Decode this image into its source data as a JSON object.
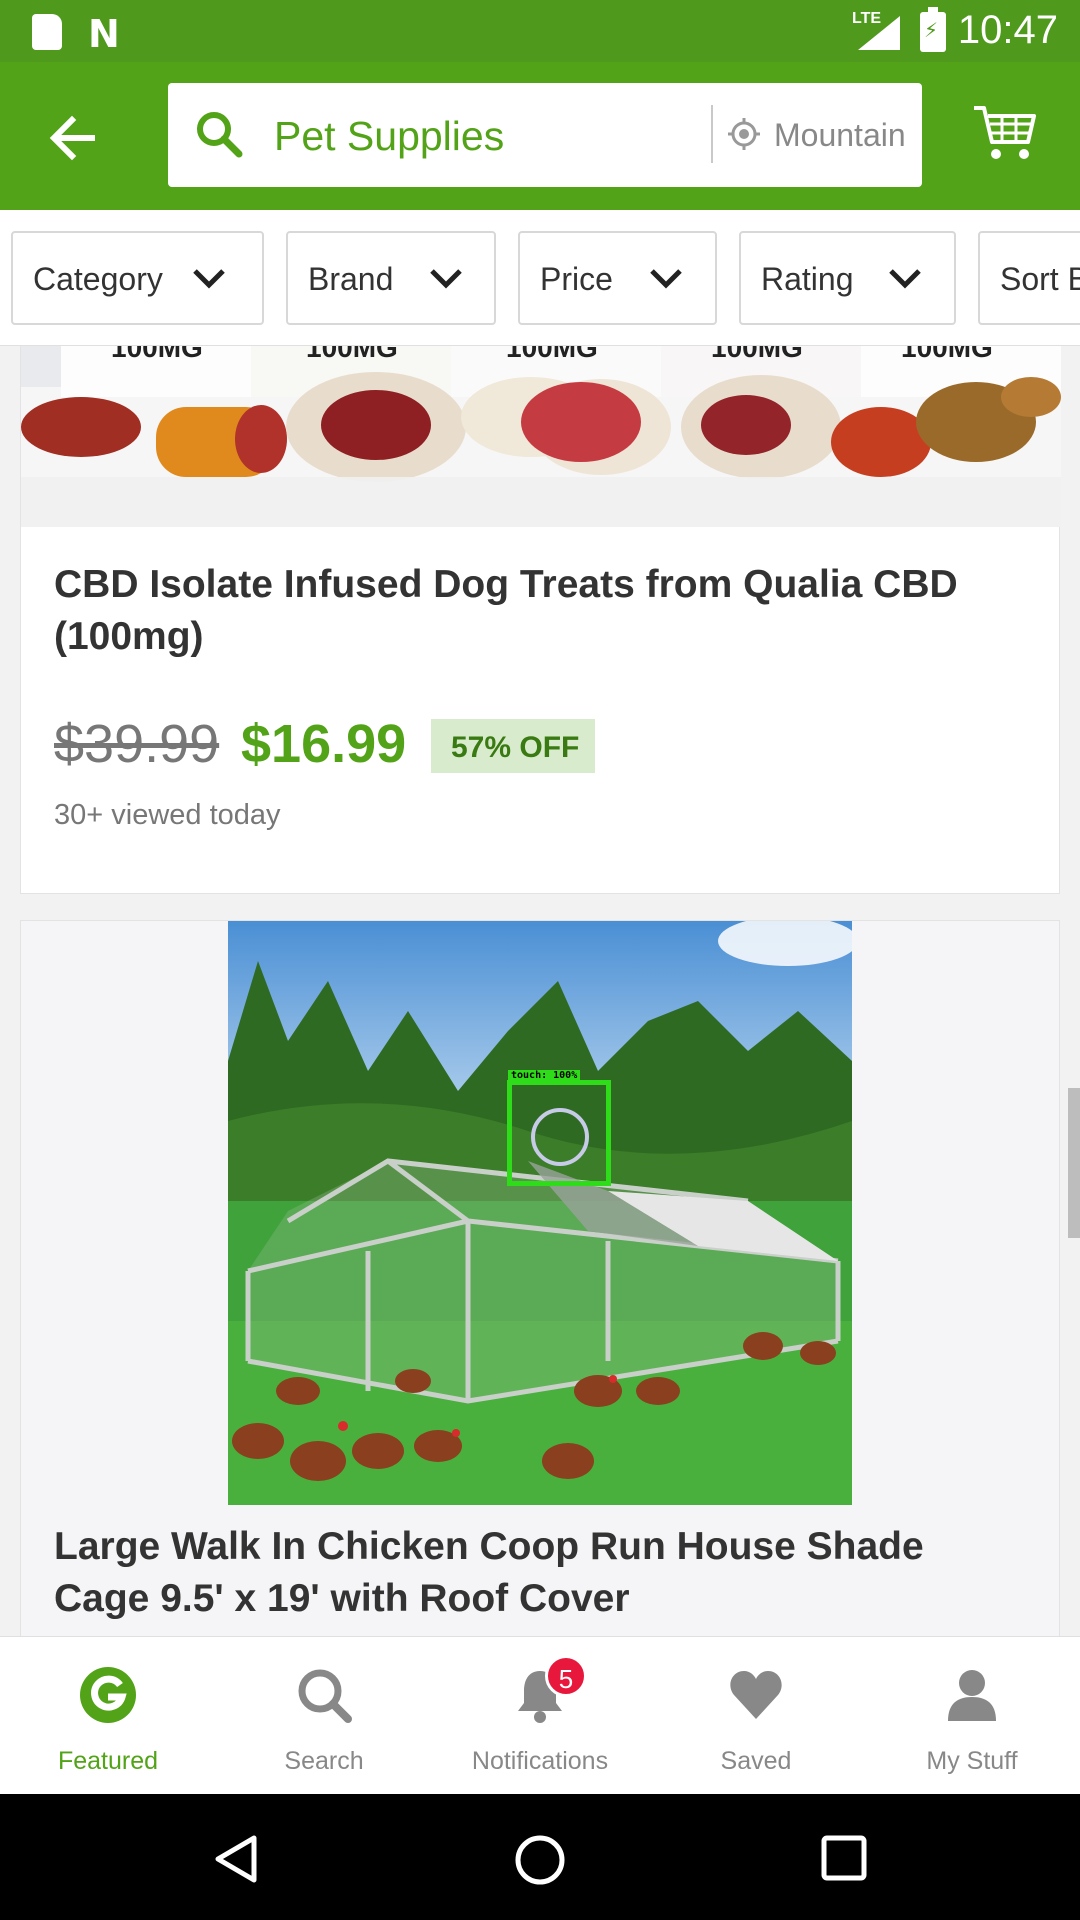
{
  "status_bar": {
    "network": "LTE",
    "time": "10:47"
  },
  "header": {
    "search_text": "Pet Supplies",
    "location_text": "Mountain View",
    "brand_color": "#53a318"
  },
  "filters": [
    {
      "label": "Category"
    },
    {
      "label": "Brand"
    },
    {
      "label": "Price"
    },
    {
      "label": "Rating"
    },
    {
      "label": "Sort By"
    }
  ],
  "products": [
    {
      "title": "CBD Isolate Infused Dog Treats from Qualia CBD (100mg)",
      "old_price": "$39.99",
      "new_price": "$16.99",
      "discount": "57% OFF",
      "viewed": "30+ viewed today",
      "image_labels": [
        "100MG",
        "100MG",
        "100MG",
        "100MG",
        "100MG"
      ]
    },
    {
      "title": "Large Walk In Chicken Coop Run House Shade Cage 9.5' x 19' with Roof Cover"
    }
  ],
  "touch_overlay": {
    "label": "touch: 100%"
  },
  "bottom_nav": [
    {
      "label": "Featured",
      "icon": "groupon-g-icon",
      "active": true
    },
    {
      "label": "Search",
      "icon": "search-icon"
    },
    {
      "label": "Notifications",
      "icon": "bell-icon",
      "badge": "5"
    },
    {
      "label": "Saved",
      "icon": "heart-icon"
    },
    {
      "label": "My Stuff",
      "icon": "person-icon"
    }
  ]
}
